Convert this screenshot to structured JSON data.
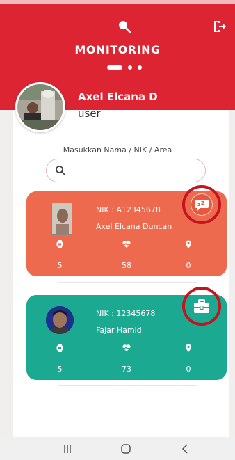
{
  "header": {
    "title": "MONITORING",
    "page_count": 3,
    "active_page": 1
  },
  "user": {
    "name": "Axel Elcana D",
    "role": "user"
  },
  "search": {
    "label": "Masukkan Nama / NIK / Area",
    "value": "",
    "placeholder": ""
  },
  "cards": [
    {
      "nik": "NIK : A12345678",
      "name": "Axel Elcana Duncan",
      "stats": [
        "5",
        "58",
        "0"
      ],
      "status_icon": "sleep-chat-icon",
      "color": "#ed6a4e"
    },
    {
      "nik": "NIK : 12345678",
      "name": "Fajar Hamid",
      "stats": [
        "5",
        "73",
        "0"
      ],
      "status_icon": "briefcase-icon",
      "color": "#1ca991"
    }
  ],
  "theme": {
    "header": "#dc2433",
    "highlight_ring": "#c3141f"
  },
  "nav": {
    "items": [
      "recent-apps-icon",
      "home-icon",
      "back-icon"
    ]
  }
}
